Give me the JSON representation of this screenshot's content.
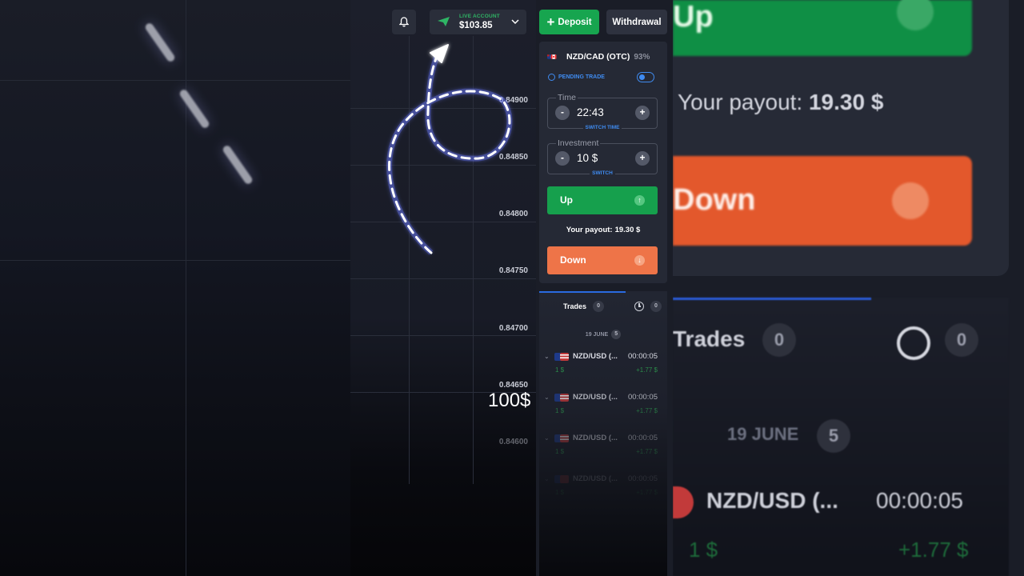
{
  "header": {
    "account_label": "LIVE ACCOUNT",
    "balance": "$103.85",
    "deposit_label": "Deposit",
    "withdraw_label": "Withdrawal"
  },
  "chart": {
    "y_ticks": [
      "0.84900",
      "0.84850",
      "0.84800",
      "0.84750",
      "0.84700",
      "0.84650",
      "0.84600"
    ],
    "overlay_text": "100$"
  },
  "trade_panel": {
    "pair": "NZD/CAD (OTC)",
    "payout_pct": "93%",
    "pending_label": "PENDING TRADE",
    "time": {
      "label": "Time",
      "value": "22:43",
      "switch_label": "SWITCH TIME",
      "minus": "-",
      "plus": "+"
    },
    "investment": {
      "label": "Investment",
      "value": "10 $",
      "switch_label": "SWITCH",
      "minus": "-",
      "plus": "+"
    },
    "up_label": "Up",
    "down_label": "Down",
    "up_icon": "↑",
    "down_icon": "↓",
    "payout_label": "Your payout:",
    "payout_value": "19.30 $"
  },
  "trades": {
    "tab_label": "Trades",
    "tab_count": "0",
    "history_count": "0",
    "date_label": "19 JUNE",
    "date_count": "5",
    "items": [
      {
        "pair": "NZD/USD (...",
        "time": "00:00:05",
        "amount": "1 $",
        "profit": "+1.77 $"
      },
      {
        "pair": "NZD/USD (...",
        "time": "00:00:05",
        "amount": "1 $",
        "profit": "+1.77 $"
      },
      {
        "pair": "NZD/USD (...",
        "time": "00:00:05",
        "amount": "1 $",
        "profit": "+1.77 $"
      },
      {
        "pair": "NZD/USD (...",
        "time": "00:00:05",
        "amount": "1 $",
        "profit": "+1.77 $"
      }
    ]
  },
  "background_right": {
    "up_label": "Up",
    "payout_label": "Your payout:",
    "payout_value": "19.30 $",
    "down_label": "Down",
    "trades_label": "Trades",
    "trades_count": "0",
    "history_count": "0",
    "date_label": "19 JUNE",
    "date_count": "5",
    "pair": "NZD/USD (...",
    "time": "00:00:05",
    "amount": "1 $",
    "profit": "+1.77 $"
  },
  "colors": {
    "up": "#16a04d",
    "down": "#ee7448",
    "accent": "#3f8bf0",
    "panel": "#252935"
  }
}
